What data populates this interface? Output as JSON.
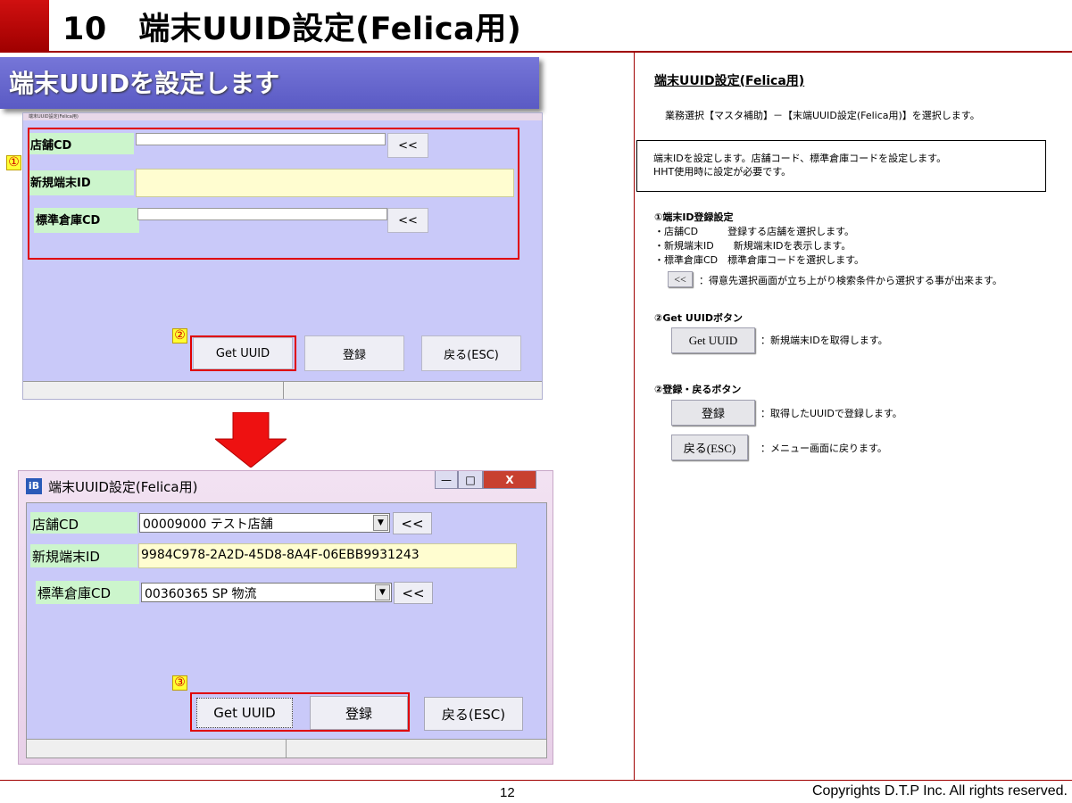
{
  "page": {
    "title": "10　端末UUID設定(Felica用)",
    "section_banner": "端末UUIDを設定します",
    "page_number": "12",
    "copyright": "Copyrights  D.T.P Inc. All rights reserved."
  },
  "screenshot_top": {
    "window_title": "端末UUID設定(Felica用)",
    "store_label": "店舗CD",
    "new_terminal_label": "新規端末ID",
    "warehouse_label": "標準倉庫CD",
    "lookup_button": "<<",
    "get_uuid_button": "Get UUID",
    "register_button": "登録",
    "back_button": "戻る(ESC)",
    "marker_1": "①",
    "marker_2": "②"
  },
  "screenshot_bottom": {
    "window_title": "端末UUID設定(Felica用)",
    "app_icon": "iB",
    "minimize": "—",
    "maximize": "□",
    "close": "X",
    "store_label": "店舗CD",
    "store_value": "00009000 テスト店舗",
    "new_terminal_label": "新規端末ID",
    "new_terminal_value": "9984C978-2A2D-45D8-8A4F-06EBB9931243",
    "warehouse_label": "標準倉庫CD",
    "warehouse_value": "00360365 SP  物流",
    "dropdown_arrow": "▼",
    "lookup_button": "<<",
    "get_uuid_button": "Get UUID",
    "register_button": "登録",
    "back_button": "戻る(ESC)",
    "marker_3": "③"
  },
  "right_panel": {
    "heading": "端末UUID設定(Felica用)",
    "menu_path": "業務選択【マスタ補助】－【末端UUID設定(Felica用)】を選択します。",
    "description_line1": "端末IDを設定します。店舗コード、標準倉庫コードを設定します。",
    "description_line2": "HHT使用時に設定が必要です。",
    "section1_title": "①端末ID登録設定",
    "section1_line1": "・店舗CD　　　登録する店舗を選択します。",
    "section1_line2": "・新規端末ID　　新規端末IDを表示します。",
    "section1_line3": "・標準倉庫CD　標準倉庫コードを選択します。",
    "lookup_button": "<<",
    "lookup_desc": "：得意先選択画面が立ち上がり検索条件から選択する事が出来ます。",
    "section2_title": "②Get UUIDボタン",
    "get_uuid_button": "Get UUID",
    "get_uuid_desc": "：新規端末IDを取得します。",
    "section3_title": "②登録・戻るボタン",
    "register_button": "登録",
    "register_desc": "：取得したUUIDで登録します。",
    "back_button": "戻る(ESC)",
    "back_desc": "：メニュー画面に戻ります。"
  },
  "colors": {
    "accent_red": "#a00000",
    "banner_purple": "#6a6ad0",
    "form_background": "#c9c9f9",
    "label_green": "#ccf5cc",
    "highlight_box": "#e00000"
  }
}
